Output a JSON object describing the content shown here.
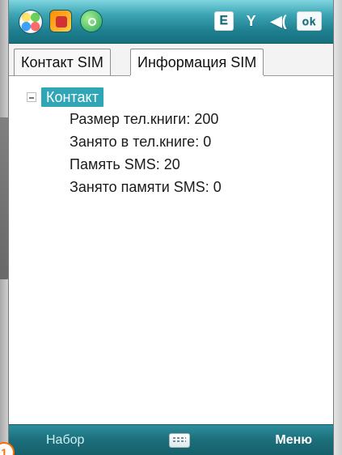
{
  "tabs": [
    {
      "label": "Контакт SIM",
      "active": false
    },
    {
      "label": "Информация SIM",
      "active": true
    }
  ],
  "tree": {
    "root_label": "Контакт",
    "expanded": true,
    "items": [
      {
        "label": "Размер тел.книги: 200"
      },
      {
        "label": "Занято в тел.книге: 0"
      },
      {
        "label": "Память SMS: 20"
      },
      {
        "label": "Занято памяти SMS: 0"
      }
    ]
  },
  "status_bar": {
    "icons": [
      {
        "name": "start-icon"
      },
      {
        "name": "app-icon"
      },
      {
        "name": "app-icon"
      }
    ],
    "indicators": [
      {
        "name": "e-indicator-icon",
        "text": "E"
      },
      {
        "name": "signal-icon",
        "text": "Y"
      },
      {
        "name": "volume-icon",
        "text": "◀("
      },
      {
        "name": "ok-button",
        "text": "ok"
      }
    ]
  },
  "softkeys": {
    "left": "Набор",
    "right": "Меню",
    "center_icon": "keyboard-icon"
  },
  "corner_badge": {
    "text": "1"
  }
}
